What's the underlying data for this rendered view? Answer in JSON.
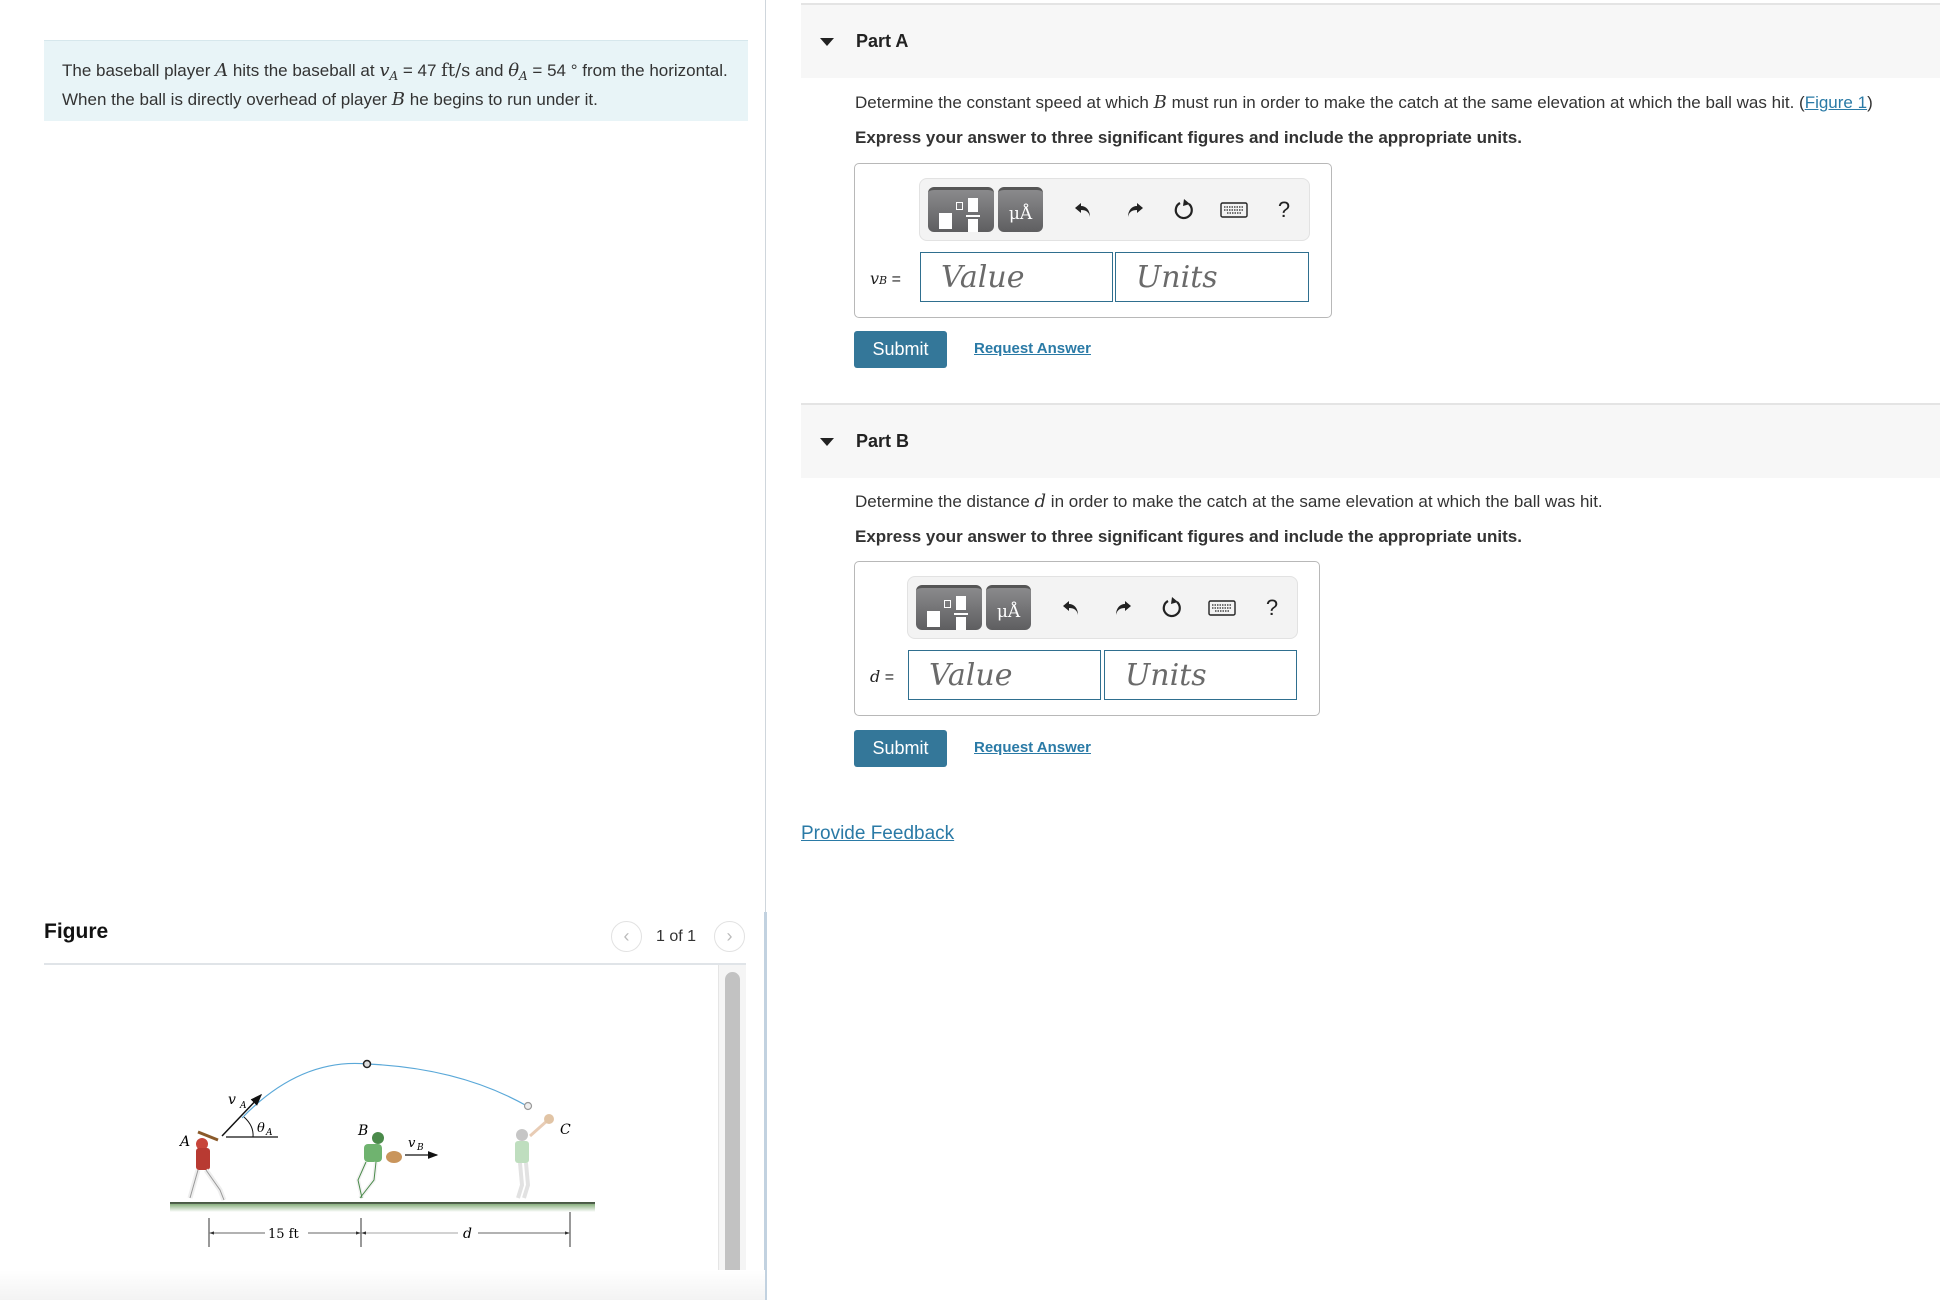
{
  "problem": {
    "t1": "The baseball player ",
    "A": "A",
    "t2": " hits the baseball at ",
    "vA_sym": "v",
    "vA_sub": "A",
    "t3": " = 47 ",
    "vA_units": "ft/s",
    "t4": " and ",
    "theta_sym": "θ",
    "theta_sub": "A",
    "t5": " = 54 °",
    "t6": " from the horizontal. When the ball is directly overhead of player ",
    "B": "B",
    "t7": " he begins to run under it."
  },
  "figure": {
    "title": "Figure",
    "prev_icon": "chevron-left-icon",
    "next_icon": "chevron-right-icon",
    "counter": "1 of 1",
    "labels": {
      "A": "A",
      "B": "B",
      "C": "C",
      "vA": "v",
      "vA_sub": "A",
      "thetaA": "θ",
      "thetaA_sub": "A",
      "vB": "v",
      "vB_sub": "B",
      "dist1": "15 ft",
      "dist2": "d"
    }
  },
  "parts": [
    {
      "title": "Part A",
      "prompt_pre": "Determine the constant speed at which ",
      "prompt_var": "B",
      "prompt_post": " must run in order to make the catch at the same elevation at which the ball was hit. (",
      "figure_link": "Figure 1",
      "prompt_end": ")",
      "instruction": "Express your answer to three significant figures and include the appropriate units.",
      "answer_label_var": "v",
      "answer_label_sub": "B",
      "answer_label_eq": " =",
      "value_placeholder": "Value",
      "units_placeholder": "Units",
      "submit": "Submit",
      "request": "Request Answer"
    },
    {
      "title": "Part B",
      "prompt_pre": "Determine the distance ",
      "prompt_var": "d",
      "prompt_post": " in order to make the catch at the same elevation at which the ball was hit.",
      "instruction": "Express your answer to three significant figures and include the appropriate units.",
      "answer_label_var": "d",
      "answer_label_eq": " =",
      "value_placeholder": "Value",
      "units_placeholder": "Units",
      "submit": "Submit",
      "request": "Request Answer"
    }
  ],
  "toolbar": {
    "templates_icon": "templates-icon",
    "units_label": "μÅ",
    "undo_icon": "undo-icon",
    "redo_icon": "redo-icon",
    "reset_icon": "reset-icon",
    "keyboard_icon": "keyboard-icon",
    "help_label": "?"
  },
  "feedback": "Provide Feedback",
  "colors": {
    "accent": "#347799",
    "link": "#2a7aa6",
    "problem_bg": "#e8f4f7",
    "header_bg": "#f7f7f7"
  }
}
